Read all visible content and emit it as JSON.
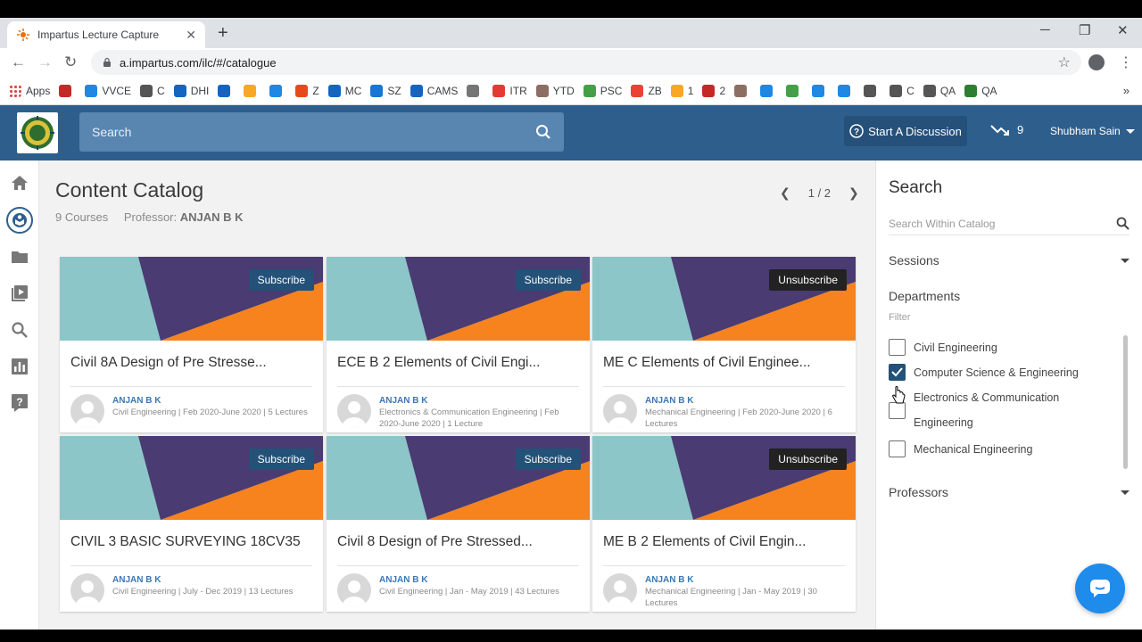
{
  "browser": {
    "tab_title": "Impartus Lecture Capture",
    "url": "a.impartus.com/ilc/#/catalogue",
    "bookmarks": [
      "Apps",
      "",
      "VVCE",
      "C",
      "DHI",
      "",
      "",
      "",
      "Z",
      "MC",
      "SZ",
      "CAMS",
      "",
      "ITR",
      "YTD",
      "PSC",
      "ZB",
      "1",
      "2",
      "",
      "",
      "",
      "",
      "",
      "",
      "C",
      "QA",
      "QA"
    ],
    "bookmark_colors": [
      "#4285f4",
      "#c62828",
      "#1e88e5",
      "#555555",
      "#1565c0",
      "#1565c0",
      "#f9a825",
      "#1e88e5",
      "#e64a19",
      "#1565c0",
      "#1976d2",
      "#1565c0",
      "#757575",
      "#e53935",
      "#8d6e63",
      "#43a047",
      "#ea4335",
      "#f9a825",
      "#c62828",
      "#8d6e63",
      "#1e88e5",
      "#43a047",
      "#1e88e5",
      "#1e88e5",
      "#555555",
      "#555555",
      "#555555",
      "#2e7d32",
      "#1a237e"
    ]
  },
  "header": {
    "search_placeholder": "Search",
    "discussion_label": "Start A Discussion",
    "trend_count": "9",
    "user_name": "Shubham Sain"
  },
  "catalog": {
    "title": "Content Catalog",
    "courses_count": "9 Courses",
    "professor_label": "Professor:",
    "professor_name": "ANJAN B K",
    "page": "1 / 2",
    "cards": [
      {
        "title": "Civil 8A Design of Pre Stresse...",
        "button": "Subscribe",
        "professor": "ANJAN B K",
        "info": "Civil Engineering | Feb 2020-June 2020 | 5 Lectures"
      },
      {
        "title": "ECE B 2 Elements of Civil Engi...",
        "button": "Subscribe",
        "professor": "ANJAN B K",
        "info": "Electronics & Communication Engineering | Feb 2020-June 2020 | 1 Lecture"
      },
      {
        "title": "ME C Elements of Civil Enginee...",
        "button": "Unsubscribe",
        "professor": "ANJAN B K",
        "info": "Mechanical Engineering | Feb 2020-June 2020 | 6 Lectures"
      },
      {
        "title": "CIVIL 3 BASIC SURVEYING 18CV35",
        "button": "Subscribe",
        "professor": "ANJAN B K",
        "info": "Civil Engineering | July - Dec 2019 | 13 Lectures"
      },
      {
        "title": "Civil 8 Design of Pre Stressed...",
        "button": "Subscribe",
        "professor": "ANJAN B K",
        "info": "Civil Engineering | Jan - May 2019 | 43 Lectures"
      },
      {
        "title": "ME B 2 Elements of Civil Engin...",
        "button": "Unsubscribe",
        "professor": "ANJAN B K",
        "info": "Mechanical Engineering | Jan - May 2019 | 30 Lectures"
      }
    ]
  },
  "panel": {
    "title": "Search",
    "search_placeholder": "Search Within Catalog",
    "sessions_label": "Sessions",
    "departments_label": "Departments",
    "filter_placeholder": "Filter",
    "departments": [
      {
        "label": "Civil Engineering",
        "checked": false
      },
      {
        "label": "Computer Science & Engineering",
        "checked": true
      },
      {
        "label": "Electronics & Communication Engineering",
        "checked": false
      },
      {
        "label": "Mechanical Engineering",
        "checked": false
      }
    ],
    "professors_label": "Professors"
  },
  "colors": {
    "header_bg": "#2e5f8c",
    "button_bg": "#245177",
    "banner_teal": "#8cc6c8",
    "banner_purple": "#4a3b72",
    "banner_orange": "#f6831e"
  },
  "icons": {
    "rail": [
      "home-icon",
      "catalog-icon",
      "folder-icon",
      "video-library-icon",
      "search-icon",
      "analytics-icon",
      "help-icon"
    ]
  }
}
